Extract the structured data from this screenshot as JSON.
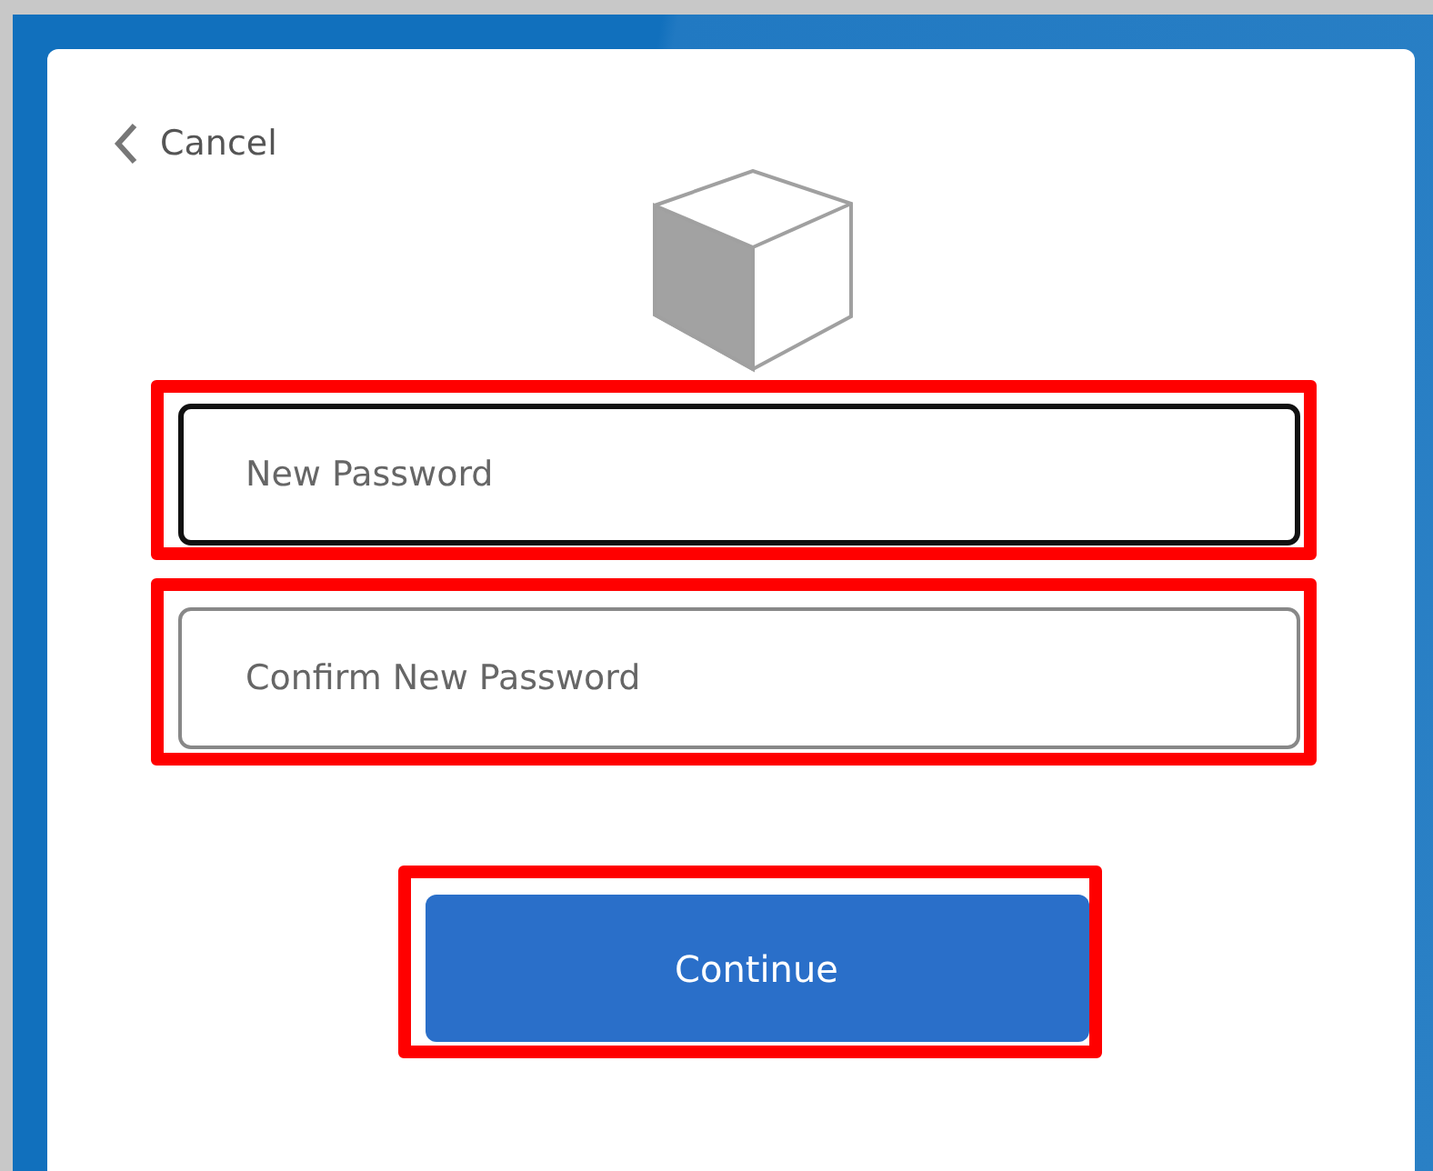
{
  "cancel": {
    "label": "Cancel"
  },
  "fields": [
    {
      "placeholder": "New Password",
      "focused": true,
      "highlighted": true
    },
    {
      "placeholder": "Confirm New Password",
      "focused": false,
      "highlighted": true
    }
  ],
  "continue_button": {
    "label": "Continue",
    "highlighted": true
  }
}
